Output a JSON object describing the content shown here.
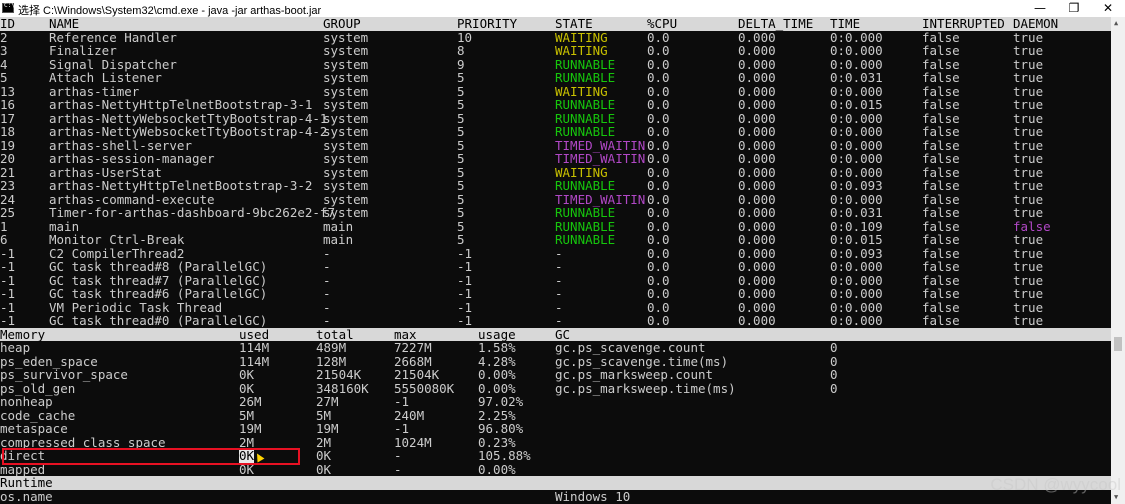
{
  "window": {
    "title": "选择 C:\\Windows\\System32\\cmd.exe - java  -jar arthas-boot.jar",
    "minimize": "—",
    "maximize": "❐",
    "close": "✕"
  },
  "colors": {
    "waiting": "#c8c000",
    "runnable": "#16c60c",
    "timed": "#b148c6",
    "header_bg": "#d8d8d8",
    "highlight": "#e81123"
  },
  "threads": {
    "headers": [
      "ID",
      "NAME",
      "GROUP",
      "PRIORITY",
      "STATE",
      "%CPU",
      "DELTA_TIME",
      "TIME",
      "INTERRUPTED",
      "DAEMON"
    ],
    "rows": [
      [
        "2",
        "Reference Handler",
        "system",
        "10",
        "WAITING",
        "0.0",
        "0.000",
        "0:0.000",
        "false",
        "true"
      ],
      [
        "3",
        "Finalizer",
        "system",
        "8",
        "WAITING",
        "0.0",
        "0.000",
        "0:0.000",
        "false",
        "true"
      ],
      [
        "4",
        "Signal Dispatcher",
        "system",
        "9",
        "RUNNABLE",
        "0.0",
        "0.000",
        "0:0.000",
        "false",
        "true"
      ],
      [
        "5",
        "Attach Listener",
        "system",
        "5",
        "RUNNABLE",
        "0.0",
        "0.000",
        "0:0.031",
        "false",
        "true"
      ],
      [
        "13",
        "arthas-timer",
        "system",
        "5",
        "WAITING",
        "0.0",
        "0.000",
        "0:0.000",
        "false",
        "true"
      ],
      [
        "16",
        "arthas-NettyHttpTelnetBootstrap-3-1",
        "system",
        "5",
        "RUNNABLE",
        "0.0",
        "0.000",
        "0:0.015",
        "false",
        "true"
      ],
      [
        "17",
        "arthas-NettyWebsocketTtyBootstrap-4-1",
        "system",
        "5",
        "RUNNABLE",
        "0.0",
        "0.000",
        "0:0.000",
        "false",
        "true"
      ],
      [
        "18",
        "arthas-NettyWebsocketTtyBootstrap-4-2",
        "system",
        "5",
        "RUNNABLE",
        "0.0",
        "0.000",
        "0:0.000",
        "false",
        "true"
      ],
      [
        "19",
        "arthas-shell-server",
        "system",
        "5",
        "TIMED_WAITIN",
        "0.0",
        "0.000",
        "0:0.000",
        "false",
        "true"
      ],
      [
        "20",
        "arthas-session-manager",
        "system",
        "5",
        "TIMED_WAITIN",
        "0.0",
        "0.000",
        "0:0.000",
        "false",
        "true"
      ],
      [
        "21",
        "arthas-UserStat",
        "system",
        "5",
        "WAITING",
        "0.0",
        "0.000",
        "0:0.000",
        "false",
        "true"
      ],
      [
        "23",
        "arthas-NettyHttpTelnetBootstrap-3-2",
        "system",
        "5",
        "RUNNABLE",
        "0.0",
        "0.000",
        "0:0.093",
        "false",
        "true"
      ],
      [
        "24",
        "arthas-command-execute",
        "system",
        "5",
        "TIMED_WAITIN",
        "0.0",
        "0.000",
        "0:0.000",
        "false",
        "true"
      ],
      [
        "25",
        "Timer-for-arthas-dashboard-9bc262e2-f7",
        "system",
        "5",
        "RUNNABLE",
        "0.0",
        "0.000",
        "0:0.031",
        "false",
        "true"
      ],
      [
        "1",
        "main",
        "main",
        "5",
        "RUNNABLE",
        "0.0",
        "0.000",
        "0:0.109",
        "false",
        "false"
      ],
      [
        "6",
        "Monitor Ctrl-Break",
        "main",
        "5",
        "RUNNABLE",
        "0.0",
        "0.000",
        "0:0.015",
        "false",
        "true"
      ],
      [
        "-1",
        "C2 CompilerThread2",
        "-",
        "-1",
        "-",
        "0.0",
        "0.000",
        "0:0.093",
        "false",
        "true"
      ],
      [
        "-1",
        "GC task thread#8 (ParallelGC)",
        "-",
        "-1",
        "-",
        "0.0",
        "0.000",
        "0:0.000",
        "false",
        "true"
      ],
      [
        "-1",
        "GC task thread#7 (ParallelGC)",
        "-",
        "-1",
        "-",
        "0.0",
        "0.000",
        "0:0.000",
        "false",
        "true"
      ],
      [
        "-1",
        "GC task thread#6 (ParallelGC)",
        "-",
        "-1",
        "-",
        "0.0",
        "0.000",
        "0:0.000",
        "false",
        "true"
      ],
      [
        "-1",
        "VM Periodic Task Thread",
        "-",
        "-1",
        "-",
        "0.0",
        "0.000",
        "0:0.000",
        "false",
        "true"
      ],
      [
        "-1",
        "GC task thread#0 (ParallelGC)",
        "-",
        "-1",
        "-",
        "0.0",
        "0.000",
        "0:0.000",
        "false",
        "true"
      ]
    ]
  },
  "memory": {
    "headers": [
      "Memory",
      "used",
      "total",
      "max",
      "usage",
      "GC"
    ],
    "rows": [
      [
        "heap",
        "114M",
        "489M",
        "7227M",
        "1.58%"
      ],
      [
        "ps_eden_space",
        "114M",
        "128M",
        "2668M",
        "4.28%"
      ],
      [
        "ps_survivor_space",
        "0K",
        "21504K",
        "21504K",
        "0.00%"
      ],
      [
        "ps_old_gen",
        "0K",
        "348160K",
        "5550080K",
        "0.00%"
      ],
      [
        "nonheap",
        "26M",
        "27M",
        "-1",
        "97.02%"
      ],
      [
        "code_cache",
        "5M",
        "5M",
        "240M",
        "2.25%"
      ],
      [
        "metaspace",
        "19M",
        "19M",
        "-1",
        "96.80%"
      ],
      [
        "compressed_class_space",
        "2M",
        "2M",
        "1024M",
        "0.23%"
      ],
      [
        "direct",
        "0K",
        "0K",
        "-",
        "105.88%"
      ],
      [
        "mapped",
        "0K",
        "0K",
        "-",
        "0.00%"
      ]
    ],
    "gc": [
      [
        "gc.ps_scavenge.count",
        "0"
      ],
      [
        "gc.ps_scavenge.time(ms)",
        "0"
      ],
      [
        "gc.ps_marksweep.count",
        "0"
      ],
      [
        "gc.ps_marksweep.time(ms)",
        "0"
      ]
    ]
  },
  "runtime": {
    "header": "Runtime",
    "rows": [
      [
        "os.name",
        "Windows 10"
      ]
    ]
  },
  "watermark": "CSDN @wyycool"
}
